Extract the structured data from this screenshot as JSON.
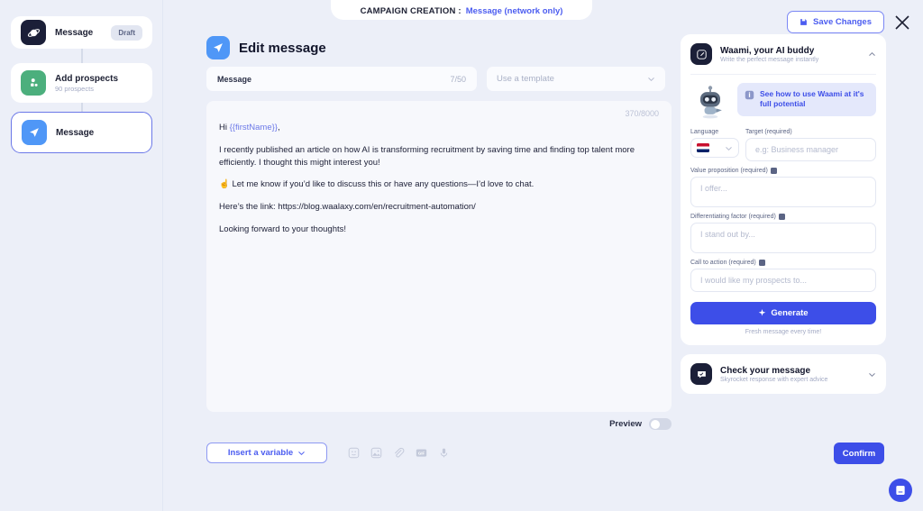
{
  "header": {
    "label": "CAMPAIGN CREATION :",
    "campaign_name": "Message (network only)",
    "save_label": "Save Changes",
    "save_icon": "save-disk-icon",
    "close_icon": "close-icon"
  },
  "sidebar": {
    "steps": [
      {
        "title": "Message",
        "subtitle": "",
        "badge": "Draft",
        "icon": "planet-icon",
        "icon_bg": "#1b1f38",
        "selected": false
      },
      {
        "title": "Add prospects",
        "subtitle": "90 prospects",
        "badge": "",
        "icon": "people-icon",
        "icon_bg": "#4caf7d",
        "selected": false
      },
      {
        "title": "Message",
        "subtitle": "",
        "badge": "",
        "icon": "send-icon",
        "icon_bg": "#4f97f7",
        "selected": true
      }
    ]
  },
  "main": {
    "title": "Edit message",
    "title_icon": "send-icon",
    "message_name_label": "Message",
    "message_name_count": "7/50",
    "template_placeholder": "Use a template",
    "char_count": "370/8000",
    "message_body": {
      "greeting_prefix": "Hi ",
      "greeting_variable": "{{firstName}}",
      "greeting_suffix": ",",
      "paragraphs": [
        "I recently published an article on how AI is transforming recruitment by saving time and finding top talent more efficiently. I thought this might interest you!",
        "☝ Let me know if you’d like to discuss this or have any questions—I’d love to chat.",
        "Here’s the link: https://blog.waalaxy.com/en/recruitment-automation/",
        "Looking forward to your thoughts!"
      ]
    },
    "preview_label": "Preview",
    "preview_on": false,
    "insert_variable_label": "Insert a variable",
    "toolbar_icons": [
      "emoji-icon",
      "image-icon",
      "attachment-icon",
      "gif-icon",
      "voice-note-icon"
    ],
    "confirm_label": "Confirm"
  },
  "right_panel": {
    "waami": {
      "title": "Waami, your AI buddy",
      "subtitle": "Write the perfect message instantly",
      "icon": "pencil-square-icon",
      "chevron": "chevron-up-icon",
      "mascot": "robot-mascot-icon",
      "banner_text": "See how to use Waami at it's full potential",
      "banner_icon": "info-icon",
      "language_label": "Language",
      "language_flag": "uk-flag-icon",
      "target_label": "Target (required)",
      "target_placeholder": "e.g: Business manager",
      "fields": [
        {
          "label": "Value proposition (required)",
          "placeholder": "I offer...",
          "tip_icon": "tooltip-icon"
        },
        {
          "label": "Differentiating factor (required)",
          "placeholder": "I stand out by...",
          "tip_icon": "tooltip-icon"
        },
        {
          "label": "Call to action (required)",
          "placeholder": "I would like my prospects to...",
          "tip_icon": "tooltip-icon"
        }
      ],
      "generate_label": "Generate",
      "generate_icon": "sparkle-icon",
      "generate_note": "Fresh message every time!"
    },
    "check_message": {
      "title": "Check your message",
      "subtitle": "Skyrocket response with expert advice",
      "icon": "message-check-icon",
      "chevron": "chevron-down-icon"
    }
  },
  "chat_bubble": {
    "icon": "chat-widget-icon"
  },
  "colors": {
    "brand_blue": "#3d4ee8",
    "link_blue": "#4b5cf0",
    "page_bg": "#eceff8",
    "dark_navy": "#1b1f38",
    "green": "#4caf7d",
    "light_blue": "#4f97f7"
  }
}
